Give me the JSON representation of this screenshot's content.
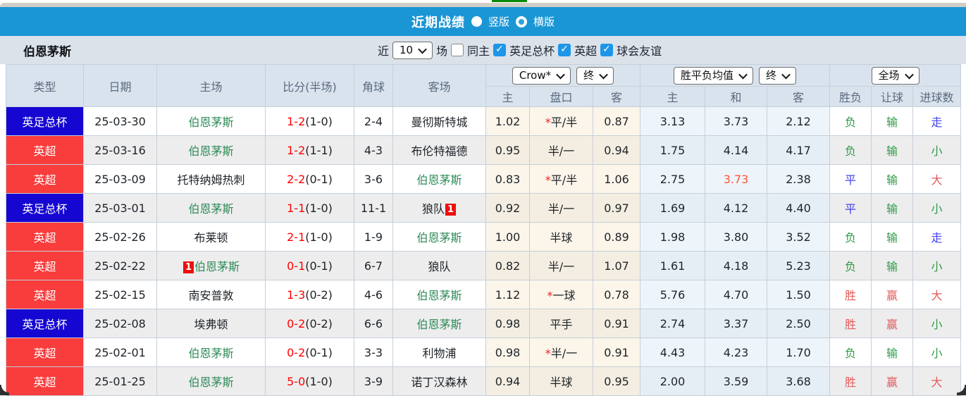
{
  "titlebar": {
    "title": "近期战绩",
    "radio_vertical": "竖版",
    "radio_horizontal": "横版",
    "selected_layout": "横版"
  },
  "filterbar": {
    "team": "伯恩茅斯",
    "recent_label": "近",
    "recent_value": "10",
    "matches_label": "场",
    "same_home_label": "同主",
    "same_home_checked": false,
    "checkboxes": [
      {
        "label": "英足总杯",
        "checked": true
      },
      {
        "label": "英超",
        "checked": true
      },
      {
        "label": "球会友谊",
        "checked": true
      }
    ]
  },
  "table": {
    "columns": [
      "类型",
      "日期",
      "主场",
      "比分(半场)",
      "角球",
      "客场"
    ],
    "odds_subcols": [
      "主",
      "盘口",
      "客"
    ],
    "mean_subcols": [
      "主",
      "和",
      "客"
    ],
    "result_subcols": [
      "胜负",
      "让球",
      "进球数"
    ],
    "dropdowns": {
      "bookmaker": "Crow*",
      "odds_time": "终",
      "mean": "胜平负均值",
      "mean_time": "终",
      "scope": "全场"
    },
    "rows": [
      {
        "type": "英足总杯",
        "type_color": "blue",
        "date": "25-03-30",
        "home": {
          "name": "伯恩茅斯",
          "green": true,
          "badge": ""
        },
        "score": "1-2",
        "half": "(1-0)",
        "corners": "2-4",
        "away": {
          "name": "曼彻斯特城",
          "green": false,
          "badge": ""
        },
        "odds": {
          "home": "1.02",
          "star": true,
          "line": "平/半",
          "away": "0.87"
        },
        "mean": {
          "home": "3.13",
          "draw": "3.73",
          "away": "2.12",
          "red": ""
        },
        "result": {
          "outcome": {
            "text": "负",
            "color": "green"
          },
          "handicap": {
            "text": "输",
            "color": "green"
          },
          "goals": {
            "text": "走",
            "color": "blue"
          }
        }
      },
      {
        "type": "英超",
        "type_color": "red",
        "date": "25-03-16",
        "home": {
          "name": "伯恩茅斯",
          "green": true,
          "badge": ""
        },
        "score": "1-2",
        "half": "(1-1)",
        "corners": "4-3",
        "away": {
          "name": "布伦特福德",
          "green": false,
          "badge": ""
        },
        "odds": {
          "home": "0.95",
          "star": false,
          "line": "半/一",
          "away": "0.94"
        },
        "mean": {
          "home": "1.75",
          "draw": "4.14",
          "away": "4.17",
          "red": ""
        },
        "result": {
          "outcome": {
            "text": "负",
            "color": "green"
          },
          "handicap": {
            "text": "输",
            "color": "green"
          },
          "goals": {
            "text": "小",
            "color": "green"
          }
        }
      },
      {
        "type": "英超",
        "type_color": "red",
        "date": "25-03-09",
        "home": {
          "name": "托特纳姆热刺",
          "green": false,
          "badge": ""
        },
        "score": "2-2",
        "half": "(0-1)",
        "corners": "3-6",
        "away": {
          "name": "伯恩茅斯",
          "green": true,
          "badge": ""
        },
        "odds": {
          "home": "0.83",
          "star": true,
          "line": "平/半",
          "away": "1.06"
        },
        "mean": {
          "home": "2.75",
          "draw": "3.73",
          "away": "2.38",
          "red": "draw"
        },
        "result": {
          "outcome": {
            "text": "平",
            "color": "blue"
          },
          "handicap": {
            "text": "输",
            "color": "green"
          },
          "goals": {
            "text": "大",
            "color": "red"
          }
        }
      },
      {
        "type": "英足总杯",
        "type_color": "blue",
        "date": "25-03-01",
        "home": {
          "name": "伯恩茅斯",
          "green": true,
          "badge": ""
        },
        "score": "1-1",
        "half": "(1-0)",
        "corners": "11-1",
        "away": {
          "name": "狼队",
          "green": false,
          "badge": "1"
        },
        "odds": {
          "home": "0.92",
          "star": false,
          "line": "半/一",
          "away": "0.97"
        },
        "mean": {
          "home": "1.69",
          "draw": "4.12",
          "away": "4.40",
          "red": ""
        },
        "result": {
          "outcome": {
            "text": "平",
            "color": "blue"
          },
          "handicap": {
            "text": "输",
            "color": "green"
          },
          "goals": {
            "text": "小",
            "color": "green"
          }
        }
      },
      {
        "type": "英超",
        "type_color": "red",
        "date": "25-02-26",
        "home": {
          "name": "布莱顿",
          "green": false,
          "badge": ""
        },
        "score": "2-1",
        "half": "(1-0)",
        "corners": "1-9",
        "away": {
          "name": "伯恩茅斯",
          "green": true,
          "badge": ""
        },
        "odds": {
          "home": "1.00",
          "star": false,
          "line": "半球",
          "away": "0.89"
        },
        "mean": {
          "home": "1.98",
          "draw": "3.80",
          "away": "3.52",
          "red": ""
        },
        "result": {
          "outcome": {
            "text": "负",
            "color": "green"
          },
          "handicap": {
            "text": "输",
            "color": "green"
          },
          "goals": {
            "text": "走",
            "color": "blue"
          }
        }
      },
      {
        "type": "英超",
        "type_color": "red",
        "date": "25-02-22",
        "home": {
          "name": "伯恩茅斯",
          "green": true,
          "badge": "1"
        },
        "score": "0-1",
        "half": "(0-1)",
        "corners": "6-7",
        "away": {
          "name": "狼队",
          "green": false,
          "badge": ""
        },
        "odds": {
          "home": "0.82",
          "star": false,
          "line": "半/一",
          "away": "1.07"
        },
        "mean": {
          "home": "1.61",
          "draw": "4.18",
          "away": "5.23",
          "red": ""
        },
        "result": {
          "outcome": {
            "text": "负",
            "color": "green"
          },
          "handicap": {
            "text": "输",
            "color": "green"
          },
          "goals": {
            "text": "小",
            "color": "green"
          }
        }
      },
      {
        "type": "英超",
        "type_color": "red",
        "date": "25-02-15",
        "home": {
          "name": "南安普敦",
          "green": false,
          "badge": ""
        },
        "score": "1-3",
        "half": "(0-2)",
        "corners": "4-6",
        "away": {
          "name": "伯恩茅斯",
          "green": true,
          "badge": ""
        },
        "odds": {
          "home": "1.12",
          "star": true,
          "line": "一球",
          "away": "0.78"
        },
        "mean": {
          "home": "5.76",
          "draw": "4.70",
          "away": "1.50",
          "red": ""
        },
        "result": {
          "outcome": {
            "text": "胜",
            "color": "red"
          },
          "handicap": {
            "text": "赢",
            "color": "red"
          },
          "goals": {
            "text": "大",
            "color": "red"
          }
        }
      },
      {
        "type": "英足总杯",
        "type_color": "blue",
        "date": "25-02-08",
        "home": {
          "name": "埃弗顿",
          "green": false,
          "badge": ""
        },
        "score": "0-2",
        "half": "(0-2)",
        "corners": "6-6",
        "away": {
          "name": "伯恩茅斯",
          "green": true,
          "badge": ""
        },
        "odds": {
          "home": "0.98",
          "star": false,
          "line": "平手",
          "away": "0.91"
        },
        "mean": {
          "home": "2.74",
          "draw": "3.37",
          "away": "2.50",
          "red": ""
        },
        "result": {
          "outcome": {
            "text": "胜",
            "color": "red"
          },
          "handicap": {
            "text": "赢",
            "color": "red"
          },
          "goals": {
            "text": "小",
            "color": "green"
          }
        }
      },
      {
        "type": "英超",
        "type_color": "red",
        "date": "25-02-01",
        "home": {
          "name": "伯恩茅斯",
          "green": true,
          "badge": ""
        },
        "score": "0-2",
        "half": "(0-1)",
        "corners": "3-3",
        "away": {
          "name": "利物浦",
          "green": false,
          "badge": ""
        },
        "odds": {
          "home": "0.98",
          "star": true,
          "line": "半/一",
          "away": "0.91"
        },
        "mean": {
          "home": "4.43",
          "draw": "4.23",
          "away": "1.70",
          "red": ""
        },
        "result": {
          "outcome": {
            "text": "负",
            "color": "green"
          },
          "handicap": {
            "text": "输",
            "color": "green"
          },
          "goals": {
            "text": "小",
            "color": "green"
          }
        }
      },
      {
        "type": "英超",
        "type_color": "red",
        "date": "25-01-25",
        "home": {
          "name": "伯恩茅斯",
          "green": true,
          "badge": ""
        },
        "score": "5-0",
        "half": "(1-0)",
        "corners": "3-9",
        "away": {
          "name": "诺丁汉森林",
          "green": false,
          "badge": ""
        },
        "odds": {
          "home": "0.94",
          "star": false,
          "line": "半球",
          "away": "0.95"
        },
        "mean": {
          "home": "2.00",
          "draw": "3.59",
          "away": "3.68",
          "red": ""
        },
        "result": {
          "outcome": {
            "text": "胜",
            "color": "red"
          },
          "handicap": {
            "text": "赢",
            "color": "red"
          },
          "goals": {
            "text": "大",
            "color": "red"
          }
        }
      }
    ]
  },
  "colors": {
    "accent_blue": "#1b96d5",
    "cup_blue": "#1606d1",
    "league_red": "#f93c3c",
    "team_green": "#2e8b57",
    "score_red": "#ff0000",
    "win_red": "#e45b5b",
    "draw_blue": "#4343ef",
    "loss_green": "#2f9b46",
    "checkbox_blue": "#1e96e8"
  }
}
